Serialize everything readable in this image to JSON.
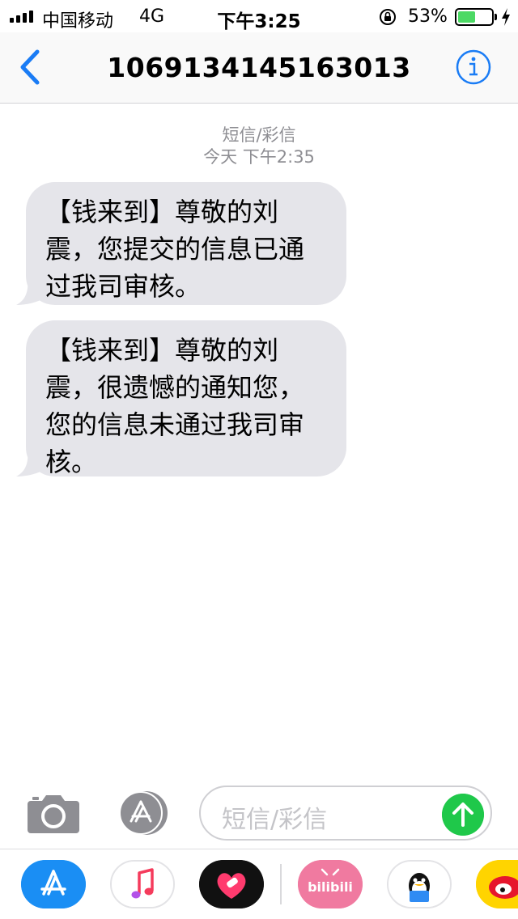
{
  "status_bar": {
    "carrier": "中国移动",
    "network": "4G",
    "time": "下午3:25",
    "battery_percent": "53%",
    "battery_level": 0.53,
    "icons": [
      "signal-icon",
      "orientation-lock-icon",
      "battery-icon",
      "charging-bolt-icon"
    ]
  },
  "nav": {
    "title": "1069134145163013",
    "back_icon": "chevron-left-icon",
    "info_icon": "info-icon",
    "accent_color": "#1a7cf5"
  },
  "conversation": {
    "type_label": "短信/彩信",
    "timestamp": "今天 下午2:35",
    "messages": [
      {
        "lines": [
          "【钱来到】尊敬的刘",
          "震，您提交的信息已通",
          "过我司审核。"
        ]
      },
      {
        "lines": [
          "【钱来到】尊敬的刘",
          "震，很遗憾的通知您，",
          "您的信息未通过我司审",
          "核。"
        ]
      }
    ],
    "bubble_color": "#e5e5ea"
  },
  "composer": {
    "placeholder": "短信/彩信",
    "camera_icon": "camera-icon",
    "appstore_icon": "app-store-icon",
    "send_icon": "send-arrow-icon",
    "send_color": "#1fc84a"
  },
  "app_drawer": {
    "apps": [
      "app-store",
      "music",
      "heart-app",
      "bilibili",
      "qq",
      "weibo"
    ],
    "bilibili_label": "bilibili"
  }
}
